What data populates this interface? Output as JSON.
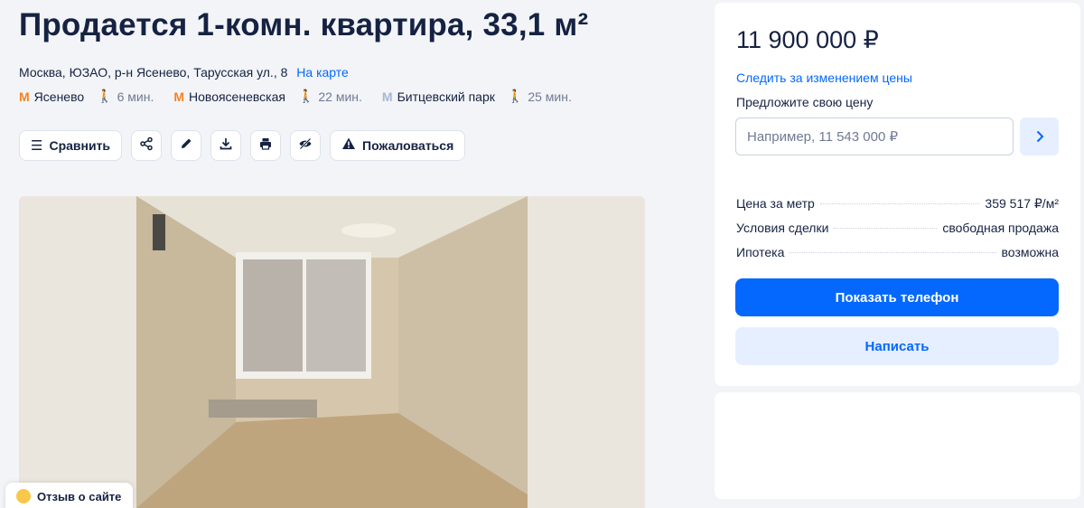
{
  "listing": {
    "title": "Продается 1-комн. квартира, 33,1 м²",
    "address": "Москва, ЮЗАО, р-н Ясенево, Тарусская ул., 8",
    "map_link": "На карте"
  },
  "metro": [
    {
      "icon": "metro-icon",
      "color": "#f58220",
      "name": "Ясенево",
      "time": "6 мин."
    },
    {
      "icon": "metro-icon",
      "color": "#f58220",
      "name": "Новоясеневская",
      "time": "22 мин."
    },
    {
      "icon": "metro-icon",
      "color": "#a6b7d3",
      "name": "Битцевский парк",
      "time": "25 мин."
    }
  ],
  "toolbar": {
    "compare": "Сравнить",
    "complain": "Пожаловаться",
    "icons": [
      "compare-icon",
      "share-icon",
      "edit-icon",
      "download-icon",
      "print-icon",
      "hide-icon",
      "warning-icon"
    ]
  },
  "sidebar": {
    "price": "11 900 000 ₽",
    "track_price": "Следить за изменением цены",
    "offer_label": "Предложите свою цену",
    "offer_placeholder": "Например, 11 543 000 ₽",
    "facts": [
      {
        "label": "Цена за метр",
        "value": "359 517 ₽/м²"
      },
      {
        "label": "Условия сделки",
        "value": "свободная продажа"
      },
      {
        "label": "Ипотека",
        "value": "возможна"
      }
    ],
    "show_phone": "Показать телефон",
    "write": "Написать"
  },
  "feedback": {
    "label": "Отзыв о сайте"
  },
  "colors": {
    "accent": "#0468ff",
    "accent_light": "#e6efff",
    "text": "#152242",
    "muted": "#707a95"
  }
}
